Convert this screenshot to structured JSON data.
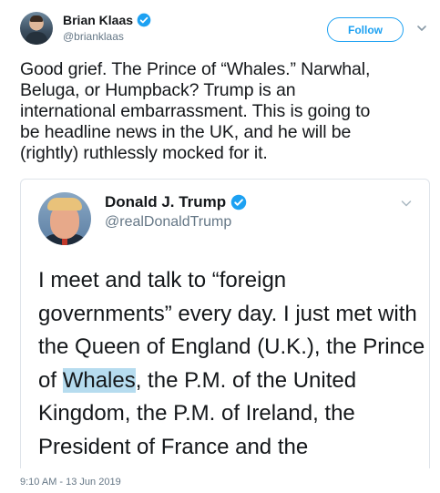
{
  "tweet": {
    "author": {
      "name": "Brian Klaas",
      "handle": "@brianklaas",
      "verified": true
    },
    "follow_label": "Follow",
    "menu_icon": "chevron-down-icon",
    "text": "Good grief. The Prince of “Whales.” Narwhal,\nBeluga, or Humpback? Trump is an\ninternational embarrassment. This is going to\nbe headline news in the UK, and he will be\n(rightly) ruthlessly mocked for it.",
    "timestamp": "9:10 AM - 13 Jun 2019"
  },
  "embedded": {
    "author": {
      "name": "Donald J. Trump",
      "handle": "@realDonaldTrump",
      "verified": true
    },
    "menu_icon": "chevron-down-icon",
    "text_before": "I meet and talk to “foreign governments” every day. I just met with the Queen of England (U.K.), the Prince of ",
    "highlighted": "Whales",
    "text_after": ", the P.M. of the United Kingdom, the P.M. of Ireland, the President of France and the"
  },
  "colors": {
    "accent": "#1da1f2",
    "text": "#14171a",
    "secondary_text": "#657786",
    "highlight": "#b6dcef",
    "border": "#dfe4ea"
  }
}
